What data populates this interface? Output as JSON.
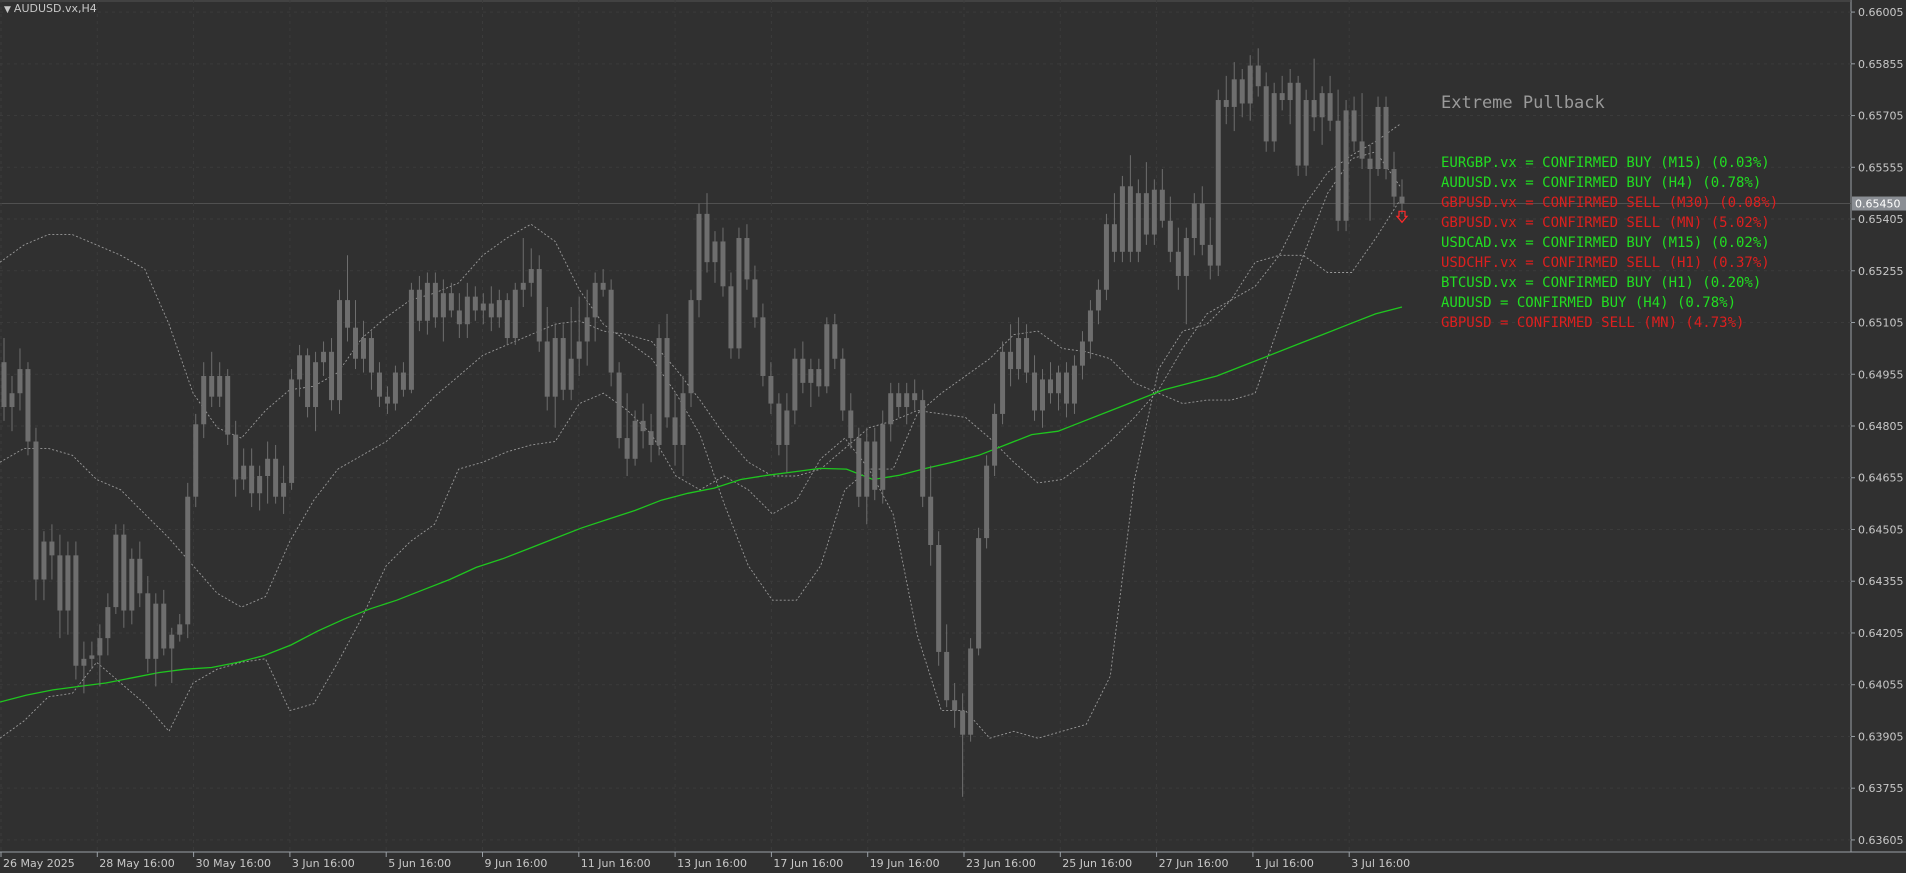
{
  "window": {
    "symbol_label": "AUDUSD.vx,H4"
  },
  "panel": {
    "title": "Extreme Pullback",
    "lines": [
      {
        "text": "EURGBP.vx = CONFIRMED BUY (M15) (0.03%)",
        "color": "#22dd22"
      },
      {
        "text": "AUDUSD.vx = CONFIRMED BUY (H4) (0.78%)",
        "color": "#22dd22"
      },
      {
        "text": "GBPUSD.vx = CONFIRMED SELL (M30) (0.08%)",
        "color": "#dd1f1f"
      },
      {
        "text": "GBPUSD.vx = CONFIRMED SELL (MN) (5.02%)",
        "color": "#dd1f1f"
      },
      {
        "text": "USDCAD.vx = CONFIRMED BUY (M15) (0.02%)",
        "color": "#22dd22"
      },
      {
        "text": "USDCHF.vx = CONFIRMED SELL (H1) (0.37%)",
        "color": "#dd1f1f"
      },
      {
        "text": "BTCUSD.vx = CONFIRMED BUY (H1) (0.20%)",
        "color": "#22dd22"
      },
      {
        "text": "AUDUSD = CONFIRMED BUY (H4) (0.78%)",
        "color": "#22dd22"
      },
      {
        "text": "GBPUSD = CONFIRMED SELL (MN) (4.73%)",
        "color": "#dd1f1f"
      }
    ]
  },
  "chart_data": {
    "type": "candlestick",
    "symbol": "AUDUSD.vx",
    "timeframe": "H4",
    "current_price": "0.65450",
    "y_ticks": [
      "0.66005",
      "0.65855",
      "0.65705",
      "0.65555",
      "0.65405",
      "0.65255",
      "0.65105",
      "0.64955",
      "0.64805",
      "0.64655",
      "0.64505",
      "0.64355",
      "0.64205",
      "0.64055",
      "0.63905",
      "0.63755",
      "0.63605"
    ],
    "ylim": [
      0.6357,
      0.6604
    ],
    "x_ticks": [
      "26 May 2025",
      "28 May 16:00",
      "30 May 16:00",
      "3 Jun 16:00",
      "5 Jun 16:00",
      "9 Jun 16:00",
      "11 Jun 16:00",
      "13 Jun 16:00",
      "17 Jun 16:00",
      "19 Jun 16:00",
      "23 Jun 16:00",
      "25 Jun 16:00",
      "27 Jun 16:00",
      "1 Jul 16:00",
      "3 Jul 16:00"
    ],
    "candles": [
      [
        0.6499,
        0.6506,
        0.6482,
        0.6486
      ],
      [
        0.6486,
        0.6495,
        0.6479,
        0.649
      ],
      [
        0.649,
        0.6503,
        0.6485,
        0.6497
      ],
      [
        0.6497,
        0.6499,
        0.6472,
        0.6476
      ],
      [
        0.6476,
        0.648,
        0.643,
        0.6436
      ],
      [
        0.6436,
        0.645,
        0.643,
        0.6447
      ],
      [
        0.6447,
        0.6452,
        0.6436,
        0.6443
      ],
      [
        0.6443,
        0.6449,
        0.6419,
        0.6427
      ],
      [
        0.6427,
        0.6447,
        0.642,
        0.6443
      ],
      [
        0.6443,
        0.6447,
        0.6407,
        0.6411
      ],
      [
        0.6411,
        0.6418,
        0.6403,
        0.6413
      ],
      [
        0.6413,
        0.6418,
        0.641,
        0.6414
      ],
      [
        0.6414,
        0.6423,
        0.6405,
        0.6419
      ],
      [
        0.6419,
        0.6432,
        0.6414,
        0.6428
      ],
      [
        0.6428,
        0.6452,
        0.6426,
        0.6449
      ],
      [
        0.6449,
        0.6452,
        0.6422,
        0.6427
      ],
      [
        0.6427,
        0.6445,
        0.6423,
        0.6442
      ],
      [
        0.6442,
        0.6447,
        0.6428,
        0.6432
      ],
      [
        0.6432,
        0.6437,
        0.6409,
        0.6413
      ],
      [
        0.6413,
        0.6432,
        0.6405,
        0.6429
      ],
      [
        0.6429,
        0.6433,
        0.6414,
        0.6416
      ],
      [
        0.6416,
        0.6422,
        0.6406,
        0.642
      ],
      [
        0.642,
        0.6426,
        0.6418,
        0.6423
      ],
      [
        0.6423,
        0.6464,
        0.6419,
        0.646
      ],
      [
        0.646,
        0.6484,
        0.6457,
        0.6481
      ],
      [
        0.6481,
        0.6499,
        0.6477,
        0.6495
      ],
      [
        0.6495,
        0.6502,
        0.6486,
        0.6489
      ],
      [
        0.6489,
        0.6499,
        0.6486,
        0.6495
      ],
      [
        0.6495,
        0.6497,
        0.6475,
        0.6478
      ],
      [
        0.6478,
        0.6482,
        0.646,
        0.6465
      ],
      [
        0.6465,
        0.6474,
        0.6462,
        0.6469
      ],
      [
        0.6469,
        0.6474,
        0.6457,
        0.6461
      ],
      [
        0.6461,
        0.6469,
        0.6456,
        0.6466
      ],
      [
        0.6466,
        0.6476,
        0.6458,
        0.6471
      ],
      [
        0.6471,
        0.6475,
        0.6458,
        0.646
      ],
      [
        0.646,
        0.6469,
        0.6455,
        0.6464
      ],
      [
        0.6464,
        0.6497,
        0.6462,
        0.6494
      ],
      [
        0.6494,
        0.6504,
        0.6489,
        0.6501
      ],
      [
        0.6501,
        0.6503,
        0.6483,
        0.6486
      ],
      [
        0.6486,
        0.6502,
        0.6479,
        0.6499
      ],
      [
        0.6499,
        0.6505,
        0.6495,
        0.6502
      ],
      [
        0.6502,
        0.6506,
        0.6485,
        0.6488
      ],
      [
        0.6488,
        0.652,
        0.6484,
        0.6517
      ],
      [
        0.6517,
        0.653,
        0.6505,
        0.6509
      ],
      [
        0.6509,
        0.6517,
        0.6497,
        0.65
      ],
      [
        0.65,
        0.6511,
        0.6496,
        0.6506
      ],
      [
        0.6506,
        0.6508,
        0.6491,
        0.6496
      ],
      [
        0.6496,
        0.6499,
        0.6486,
        0.6489
      ],
      [
        0.6489,
        0.6492,
        0.6484,
        0.6487
      ],
      [
        0.6487,
        0.6498,
        0.6485,
        0.6496
      ],
      [
        0.6496,
        0.6499,
        0.6489,
        0.6491
      ],
      [
        0.6491,
        0.6522,
        0.649,
        0.652
      ],
      [
        0.652,
        0.6524,
        0.6508,
        0.6511
      ],
      [
        0.6511,
        0.6525,
        0.6507,
        0.6522
      ],
      [
        0.6522,
        0.6525,
        0.6509,
        0.6512
      ],
      [
        0.6512,
        0.6523,
        0.6505,
        0.6519
      ],
      [
        0.6519,
        0.6522,
        0.6512,
        0.6514
      ],
      [
        0.6514,
        0.6519,
        0.6506,
        0.651
      ],
      [
        0.651,
        0.6522,
        0.6506,
        0.6518
      ],
      [
        0.6518,
        0.6521,
        0.6511,
        0.6514
      ],
      [
        0.6514,
        0.6519,
        0.651,
        0.6516
      ],
      [
        0.6516,
        0.6521,
        0.6508,
        0.6512
      ],
      [
        0.6512,
        0.652,
        0.6509,
        0.6517
      ],
      [
        0.6517,
        0.6519,
        0.6504,
        0.6506
      ],
      [
        0.6506,
        0.6522,
        0.6504,
        0.652
      ],
      [
        0.652,
        0.6535,
        0.6515,
        0.6522
      ],
      [
        0.6522,
        0.6532,
        0.6518,
        0.6526
      ],
      [
        0.6526,
        0.653,
        0.6502,
        0.6505
      ],
      [
        0.6505,
        0.6515,
        0.6485,
        0.6489
      ],
      [
        0.6489,
        0.651,
        0.648,
        0.6506
      ],
      [
        0.6506,
        0.651,
        0.6488,
        0.6491
      ],
      [
        0.6491,
        0.6515,
        0.6488,
        0.65
      ],
      [
        0.65,
        0.6518,
        0.6495,
        0.6505
      ],
      [
        0.6505,
        0.652,
        0.6498,
        0.6512
      ],
      [
        0.6512,
        0.6525,
        0.6505,
        0.6522
      ],
      [
        0.6522,
        0.6526,
        0.6518,
        0.652
      ],
      [
        0.652,
        0.6523,
        0.6492,
        0.6496
      ],
      [
        0.6496,
        0.6499,
        0.6474,
        0.6477
      ],
      [
        0.6477,
        0.649,
        0.6466,
        0.6471
      ],
      [
        0.6471,
        0.6485,
        0.6469,
        0.6482
      ],
      [
        0.6482,
        0.6487,
        0.6474,
        0.6479
      ],
      [
        0.6479,
        0.6484,
        0.647,
        0.6475
      ],
      [
        0.6475,
        0.651,
        0.6472,
        0.6506
      ],
      [
        0.6506,
        0.6513,
        0.648,
        0.6483
      ],
      [
        0.6483,
        0.649,
        0.6469,
        0.6475
      ],
      [
        0.6475,
        0.6495,
        0.6466,
        0.649
      ],
      [
        0.649,
        0.652,
        0.6486,
        0.6517
      ],
      [
        0.6517,
        0.6545,
        0.6512,
        0.6542
      ],
      [
        0.6542,
        0.6548,
        0.6525,
        0.6528
      ],
      [
        0.6528,
        0.6537,
        0.6522,
        0.6534
      ],
      [
        0.6534,
        0.6538,
        0.6518,
        0.6521
      ],
      [
        0.6521,
        0.6525,
        0.65,
        0.6503
      ],
      [
        0.6503,
        0.6538,
        0.65,
        0.6535
      ],
      [
        0.6535,
        0.6539,
        0.652,
        0.6523
      ],
      [
        0.6523,
        0.6527,
        0.6509,
        0.6512
      ],
      [
        0.6512,
        0.6516,
        0.6492,
        0.6495
      ],
      [
        0.6495,
        0.6499,
        0.6484,
        0.6487
      ],
      [
        0.6487,
        0.649,
        0.6472,
        0.6475
      ],
      [
        0.6475,
        0.649,
        0.6467,
        0.6485
      ],
      [
        0.6485,
        0.6503,
        0.6481,
        0.65
      ],
      [
        0.65,
        0.6505,
        0.649,
        0.6493
      ],
      [
        0.6493,
        0.65,
        0.6486,
        0.6497
      ],
      [
        0.6497,
        0.65,
        0.6489,
        0.6492
      ],
      [
        0.6492,
        0.6512,
        0.649,
        0.651
      ],
      [
        0.651,
        0.6513,
        0.6497,
        0.65
      ],
      [
        0.65,
        0.6503,
        0.6482,
        0.6485
      ],
      [
        0.6485,
        0.649,
        0.6474,
        0.6477
      ],
      [
        0.6477,
        0.648,
        0.6457,
        0.646
      ],
      [
        0.646,
        0.648,
        0.6452,
        0.6476
      ],
      [
        0.6476,
        0.648,
        0.6459,
        0.6462
      ],
      [
        0.6462,
        0.6485,
        0.6458,
        0.6481
      ],
      [
        0.6481,
        0.6493,
        0.6476,
        0.649
      ],
      [
        0.649,
        0.6493,
        0.6483,
        0.6486
      ],
      [
        0.6486,
        0.6493,
        0.6481,
        0.649
      ],
      [
        0.649,
        0.6494,
        0.6485,
        0.6488
      ],
      [
        0.6488,
        0.6491,
        0.6457,
        0.646
      ],
      [
        0.646,
        0.6469,
        0.644,
        0.6446
      ],
      [
        0.6446,
        0.645,
        0.6411,
        0.6415
      ],
      [
        0.6415,
        0.6423,
        0.6399,
        0.6401
      ],
      [
        0.6401,
        0.6406,
        0.6393,
        0.6398
      ],
      [
        0.6398,
        0.6403,
        0.6373,
        0.6391
      ],
      [
        0.6391,
        0.6419,
        0.6389,
        0.6416
      ],
      [
        0.6416,
        0.6451,
        0.6414,
        0.6448
      ],
      [
        0.6448,
        0.6472,
        0.6445,
        0.6469
      ],
      [
        0.6469,
        0.6487,
        0.6466,
        0.6484
      ],
      [
        0.6484,
        0.6505,
        0.6481,
        0.6502
      ],
      [
        0.6502,
        0.651,
        0.6492,
        0.6497
      ],
      [
        0.6497,
        0.6512,
        0.6494,
        0.6506
      ],
      [
        0.6506,
        0.651,
        0.6493,
        0.6496
      ],
      [
        0.6496,
        0.6501,
        0.6482,
        0.6485
      ],
      [
        0.6485,
        0.6497,
        0.648,
        0.6494
      ],
      [
        0.6494,
        0.6499,
        0.6487,
        0.649
      ],
      [
        0.649,
        0.6498,
        0.6485,
        0.6496
      ],
      [
        0.6496,
        0.6499,
        0.6483,
        0.6487
      ],
      [
        0.6487,
        0.6501,
        0.6484,
        0.6498
      ],
      [
        0.6498,
        0.6508,
        0.6494,
        0.6505
      ],
      [
        0.6505,
        0.6517,
        0.65,
        0.6514
      ],
      [
        0.6514,
        0.6523,
        0.651,
        0.652
      ],
      [
        0.652,
        0.6542,
        0.6517,
        0.6539
      ],
      [
        0.6539,
        0.6548,
        0.6528,
        0.6531
      ],
      [
        0.6531,
        0.6553,
        0.6528,
        0.655
      ],
      [
        0.655,
        0.6559,
        0.6528,
        0.6531
      ],
      [
        0.6531,
        0.6552,
        0.6528,
        0.6548
      ],
      [
        0.6548,
        0.6557,
        0.6533,
        0.6536
      ],
      [
        0.6536,
        0.6552,
        0.6533,
        0.6549
      ],
      [
        0.6549,
        0.6555,
        0.6538,
        0.654
      ],
      [
        0.654,
        0.6547,
        0.6528,
        0.6531
      ],
      [
        0.6531,
        0.6538,
        0.652,
        0.6524
      ],
      [
        0.6524,
        0.6538,
        0.651,
        0.6535
      ],
      [
        0.6535,
        0.6548,
        0.653,
        0.6545
      ],
      [
        0.6545,
        0.655,
        0.653,
        0.6533
      ],
      [
        0.6533,
        0.6541,
        0.6523,
        0.6527
      ],
      [
        0.6527,
        0.6578,
        0.6524,
        0.6575
      ],
      [
        0.6575,
        0.6582,
        0.6568,
        0.6573
      ],
      [
        0.6573,
        0.6586,
        0.6566,
        0.6581
      ],
      [
        0.6581,
        0.6584,
        0.657,
        0.6574
      ],
      [
        0.6574,
        0.6588,
        0.6569,
        0.6585
      ],
      [
        0.6585,
        0.659,
        0.6576,
        0.6579
      ],
      [
        0.6579,
        0.6583,
        0.656,
        0.6563
      ],
      [
        0.6563,
        0.658,
        0.656,
        0.6577
      ],
      [
        0.6577,
        0.6582,
        0.6572,
        0.6575
      ],
      [
        0.6575,
        0.6584,
        0.6568,
        0.658
      ],
      [
        0.658,
        0.6582,
        0.6553,
        0.6556
      ],
      [
        0.6556,
        0.6578,
        0.6553,
        0.6575
      ],
      [
        0.6575,
        0.6587,
        0.6566,
        0.657
      ],
      [
        0.657,
        0.6579,
        0.6562,
        0.6577
      ],
      [
        0.6577,
        0.6582,
        0.6566,
        0.6569
      ],
      [
        0.6569,
        0.6578,
        0.6537,
        0.654
      ],
      [
        0.654,
        0.6575,
        0.6537,
        0.6572
      ],
      [
        0.6572,
        0.6576,
        0.656,
        0.6563
      ],
      [
        0.6563,
        0.6577,
        0.6555,
        0.6558
      ],
      [
        0.6558,
        0.6562,
        0.654,
        0.6555
      ],
      [
        0.6555,
        0.6576,
        0.6553,
        0.6573
      ],
      [
        0.6573,
        0.6576,
        0.6552,
        0.6555
      ],
      [
        0.6555,
        0.656,
        0.6544,
        0.6547
      ],
      [
        0.6547,
        0.6552,
        0.6542,
        0.6545
      ]
    ],
    "bollinger_upper": [
      0.6528,
      0.6533,
      0.6536,
      0.6536,
      0.6533,
      0.653,
      0.6526,
      0.651,
      0.649,
      0.648,
      0.6477,
      0.6485,
      0.6491,
      0.6492,
      0.6496,
      0.6506,
      0.6512,
      0.6517,
      0.6519,
      0.6522,
      0.653,
      0.6535,
      0.6539,
      0.6534,
      0.652,
      0.651,
      0.6505,
      0.65,
      0.649,
      0.6478,
      0.6458,
      0.644,
      0.643,
      0.643,
      0.644,
      0.6462,
      0.6468,
      0.6468,
      0.6484,
      0.649,
      0.6495,
      0.65,
      0.6507,
      0.6508,
      0.6503,
      0.6502,
      0.65,
      0.6493,
      0.649,
      0.6487,
      0.6488,
      0.6488,
      0.649,
      0.651,
      0.653,
      0.6548,
      0.6558,
      0.656,
      0.655
    ],
    "bollinger_mid": [
      0.647,
      0.6474,
      0.6474,
      0.6472,
      0.6465,
      0.6462,
      0.6455,
      0.6448,
      0.644,
      0.6432,
      0.6428,
      0.6431,
      0.6447,
      0.6459,
      0.6468,
      0.6472,
      0.6476,
      0.6482,
      0.6489,
      0.6495,
      0.6501,
      0.6504,
      0.6507,
      0.651,
      0.6511,
      0.6508,
      0.6507,
      0.6505,
      0.6497,
      0.6488,
      0.6478,
      0.647,
      0.6466,
      0.6466,
      0.6468,
      0.6474,
      0.648,
      0.6482,
      0.6485,
      0.6484,
      0.6483,
      0.6477,
      0.647,
      0.6464,
      0.6465,
      0.647,
      0.6476,
      0.6483,
      0.6491,
      0.6503,
      0.6513,
      0.6517,
      0.6521,
      0.653,
      0.6544,
      0.6554,
      0.6559,
      0.6563,
      0.6568
    ],
    "bollinger_lower": [
      0.639,
      0.6395,
      0.6402,
      0.6403,
      0.6412,
      0.6406,
      0.64,
      0.6392,
      0.6406,
      0.641,
      0.6412,
      0.6413,
      0.6398,
      0.64,
      0.6412,
      0.6425,
      0.644,
      0.6447,
      0.6452,
      0.6468,
      0.647,
      0.6473,
      0.6475,
      0.6476,
      0.6487,
      0.649,
      0.6485,
      0.6478,
      0.6466,
      0.6462,
      0.6466,
      0.6462,
      0.6455,
      0.6459,
      0.6471,
      0.6477,
      0.6468,
      0.6455,
      0.642,
      0.6398,
      0.6398,
      0.639,
      0.6392,
      0.639,
      0.6392,
      0.6394,
      0.6408,
      0.6465,
      0.6497,
      0.6508,
      0.651,
      0.6517,
      0.6528,
      0.653,
      0.653,
      0.6525,
      0.6525,
      0.6535,
      0.6546
    ],
    "moving_average": [
      0.64005,
      0.64025,
      0.6404,
      0.6405,
      0.6406,
      0.64075,
      0.6409,
      0.641,
      0.64105,
      0.6412,
      0.6414,
      0.6417,
      0.6421,
      0.64245,
      0.64275,
      0.643,
      0.6433,
      0.6436,
      0.64395,
      0.6442,
      0.6445,
      0.6448,
      0.6451,
      0.64535,
      0.6456,
      0.6459,
      0.6461,
      0.64625,
      0.6465,
      0.64662,
      0.64672,
      0.64682,
      0.6468,
      0.6465,
      0.64662,
      0.64682,
      0.647,
      0.6472,
      0.6475,
      0.6478,
      0.6479,
      0.6482,
      0.6485,
      0.6488,
      0.6491,
      0.6493,
      0.6495,
      0.6498,
      0.6501,
      0.6504,
      0.6507,
      0.651,
      0.6513,
      0.6515
    ]
  }
}
